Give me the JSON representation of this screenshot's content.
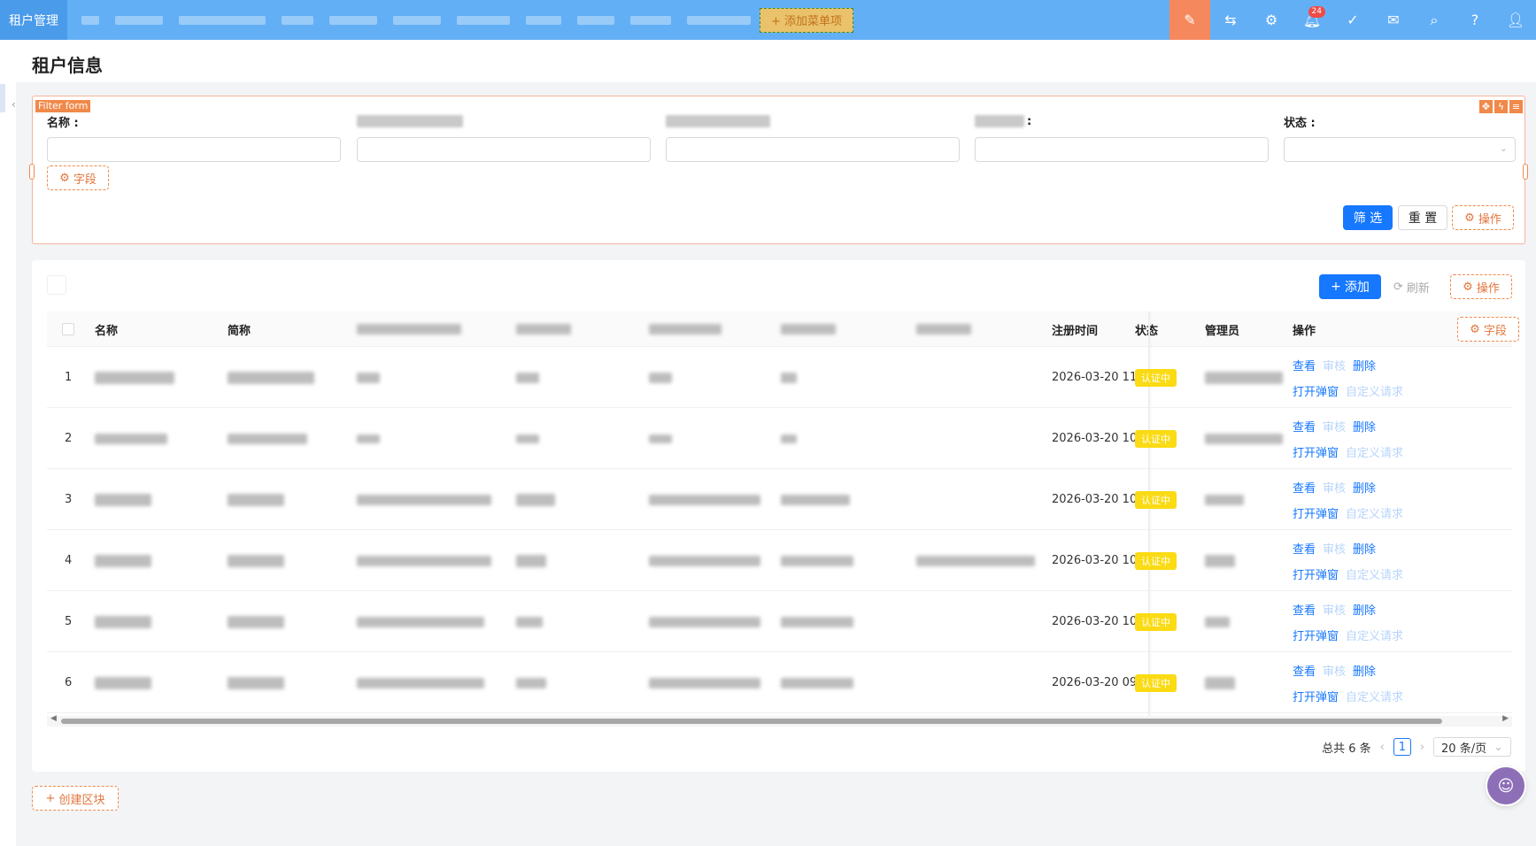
{
  "topbar": {
    "brand": "租户管理",
    "add_menu_label": "+ 添加菜单项",
    "notification_count": "24",
    "icons": [
      "pen-icon",
      "switch-icon",
      "settings-icon",
      "bell-icon",
      "check-circle-icon",
      "mail-icon",
      "search-icon",
      "help-icon",
      "user-icon"
    ]
  },
  "page": {
    "title": "租户信息"
  },
  "filter_form": {
    "tag": "Filter form",
    "fields": [
      {
        "label": "名称 :"
      },
      {
        "label": ""
      },
      {
        "label": ""
      },
      {
        "label": ":"
      },
      {
        "label": "状态 :"
      }
    ],
    "fields_button": "字段",
    "filter_button": "筛 选",
    "reset_button": "重 置",
    "actions_button": "操作"
  },
  "table_toolbar": {
    "add_button": "添加",
    "refresh_button": "刷新",
    "actions_button": "操作"
  },
  "table": {
    "columns": {
      "name": "名称",
      "short_name": "简称",
      "register_time": "注册时间",
      "status": "状态",
      "admin": "管理员",
      "actions": "操作",
      "fields_button": "字段"
    },
    "rows": [
      {
        "index": "1",
        "register_time": "2026-03-20 11",
        "status": "认证中"
      },
      {
        "index": "2",
        "register_time": "2026-03-20 10",
        "status": "认证中"
      },
      {
        "index": "3",
        "register_time": "2026-03-20 10",
        "status": "认证中"
      },
      {
        "index": "4",
        "register_time": "2026-03-20 10",
        "status": "认证中"
      },
      {
        "index": "5",
        "register_time": "2026-03-20 10",
        "status": "认证中"
      },
      {
        "index": "6",
        "register_time": "2026-03-20 09",
        "status": "认证中"
      }
    ],
    "row_actions": {
      "view": "查看",
      "audit": "审核",
      "delete": "删除",
      "open_dialog": "打开弹窗",
      "custom_request": "自定义请求"
    }
  },
  "pagination": {
    "total": "总共 6 条",
    "current_page": "1",
    "page_size": "20 条/页"
  },
  "create_block_button": "创建区块",
  "colors": {
    "topbar": "#63aff6",
    "primary": "#1677ff",
    "accent_orange": "#f0894a",
    "status_yellow": "#fadb14"
  }
}
